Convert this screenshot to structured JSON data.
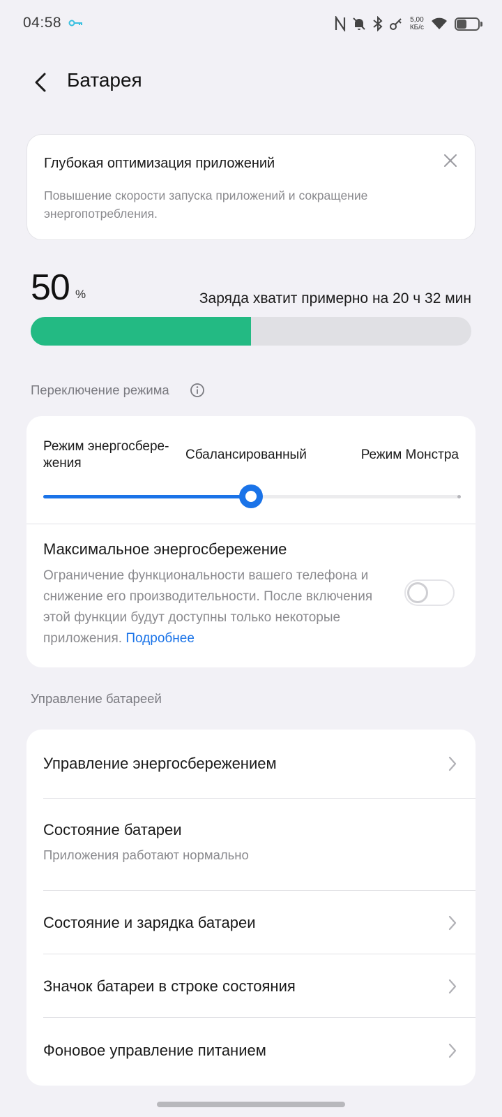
{
  "status_bar": {
    "time": "04:58",
    "net_speed_value": "5,00",
    "net_speed_unit": "КБ/с"
  },
  "header": {
    "title": "Батарея"
  },
  "promo": {
    "title": "Глубокая оптимизация приложений",
    "description": "Повышение скорости запуска приложений и сокращение энергопотребления."
  },
  "battery": {
    "level": 50,
    "level_text": "50",
    "percent_sign": "%",
    "remaining": "Заряда хватит примерно на 20 ч 32 мин",
    "fill_color": "#23ba83"
  },
  "mode_section": {
    "label": "Переключение режима",
    "modes": [
      "Режим энергосбере-жения",
      "Сбалансированный",
      "Режим Монстра"
    ],
    "selected_index": 1,
    "accent_color": "#1a73e8",
    "max_saving": {
      "title": "Максимальное энергосбережение",
      "description": "Ограничение функциональности вашего телефона и снижение его производительности. После включения этой функции будут доступны только некоторые приложения. ",
      "link": "Подробнее",
      "enabled": false
    }
  },
  "management": {
    "label": "Управление батареей",
    "items": [
      {
        "label": "Управление энергосбережением"
      },
      {
        "label": "Состояние батареи",
        "sub": "Приложения работают нормально"
      },
      {
        "label": "Состояние и зарядка батареи"
      },
      {
        "label": "Значок батареи в строке состояния"
      },
      {
        "label": "Фоновое управление питанием"
      }
    ]
  }
}
